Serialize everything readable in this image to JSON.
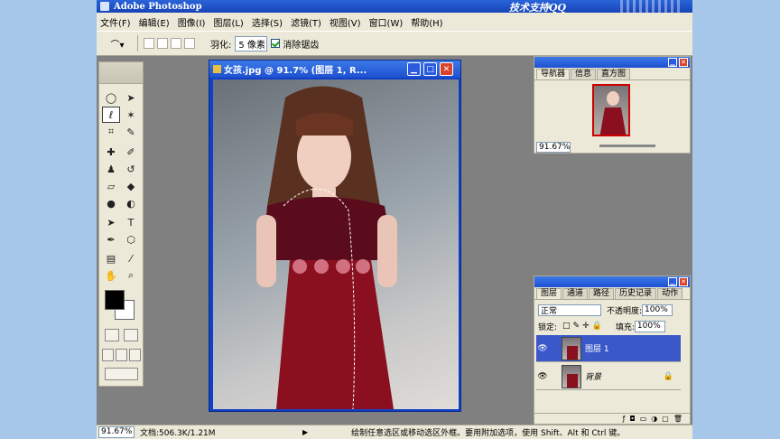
{
  "app": {
    "title": "Adobe Photoshop",
    "watermark": "技术支持QQ"
  },
  "menu": [
    "文件(F)",
    "编辑(E)",
    "图像(I)",
    "图层(L)",
    "选择(S)",
    "滤镜(T)",
    "视图(V)",
    "窗口(W)",
    "帮助(H)"
  ],
  "options": {
    "feather_label": "羽化:",
    "feather_value": "5 像素",
    "antialias_label": "消除锯齿",
    "antialias_checked": true
  },
  "document": {
    "title": "女孩.jpg @ 91.7% (图层 1, R..."
  },
  "navigator": {
    "tabs": [
      "导航器",
      "信息",
      "直方图"
    ],
    "zoom": "91.67%"
  },
  "layers_panel": {
    "tabs": [
      "图层",
      "通道",
      "路径",
      "历史记录",
      "动作"
    ],
    "blend_mode": "正常",
    "opacity_label": "不透明度:",
    "opacity": "100%",
    "lock_label": "锁定:",
    "fill_label": "填充:",
    "fill": "100%",
    "layers": [
      {
        "name": "图层 1",
        "selected": true
      },
      {
        "name": "背景",
        "selected": false
      }
    ]
  },
  "status": {
    "zoom": "91.67%",
    "doc": "文档:506.3K/1.21M",
    "hint": "绘制任意选区或移动选区外框。要用附加选项，使用 Shift、Alt 和 Ctrl 键。"
  },
  "colors": {
    "titlebar": "#1e50d0",
    "panel": "#ece9d8",
    "workspace": "#808080",
    "dress": "#8a1020",
    "desktop": "#a6c7e9"
  }
}
